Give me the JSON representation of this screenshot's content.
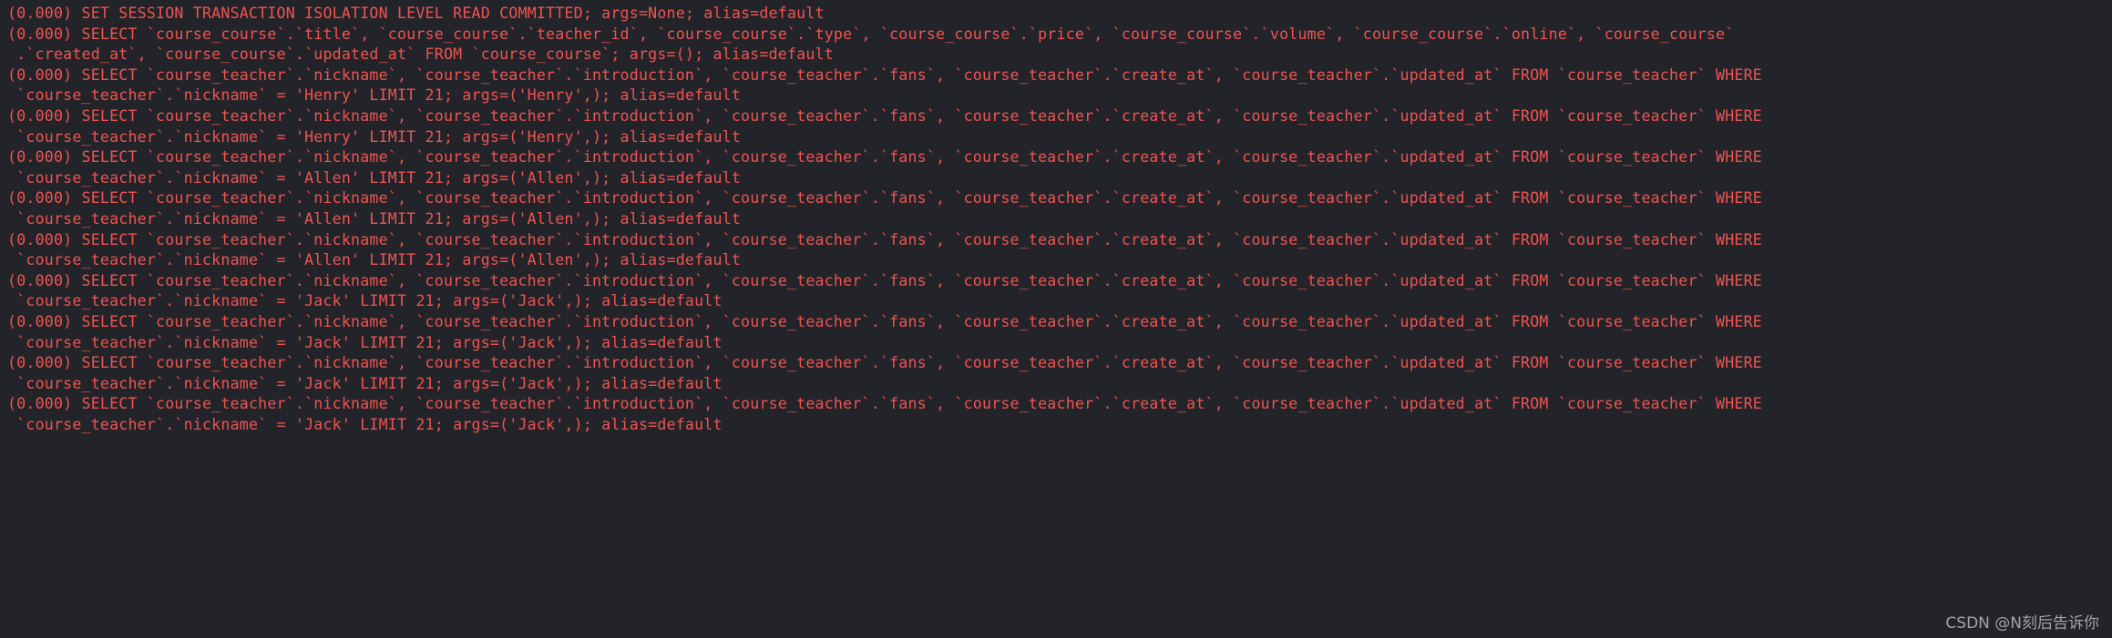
{
  "console": {
    "background_color": "#23242a",
    "text_color": "#ef5350",
    "watermark_color": "#b9babd",
    "font_size_px": 16.6,
    "line_height_px": 22.6,
    "line_count": 30,
    "lines": [
      "(0.000) SET SESSION TRANSACTION ISOLATION LEVEL READ COMMITTED; args=None; alias=default",
      "(0.000) SELECT `course_course`.`title`, `course_course`.`teacher_id`, `course_course`.`type`, `course_course`.`price`, `course_course`.`volume`, `course_course`.`online`, `course_course`",
      " .`created_at`, `course_course`.`updated_at` FROM `course_course`; args=(); alias=default",
      "(0.000) SELECT `course_teacher`.`nickname`, `course_teacher`.`introduction`, `course_teacher`.`fans`, `course_teacher`.`create_at`, `course_teacher`.`updated_at` FROM `course_teacher` WHERE",
      " `course_teacher`.`nickname` = 'Henry' LIMIT 21; args=('Henry',); alias=default",
      "(0.000) SELECT `course_teacher`.`nickname`, `course_teacher`.`introduction`, `course_teacher`.`fans`, `course_teacher`.`create_at`, `course_teacher`.`updated_at` FROM `course_teacher` WHERE",
      " `course_teacher`.`nickname` = 'Henry' LIMIT 21; args=('Henry',); alias=default",
      "(0.000) SELECT `course_teacher`.`nickname`, `course_teacher`.`introduction`, `course_teacher`.`fans`, `course_teacher`.`create_at`, `course_teacher`.`updated_at` FROM `course_teacher` WHERE",
      " `course_teacher`.`nickname` = 'Allen' LIMIT 21; args=('Allen',); alias=default",
      "(0.000) SELECT `course_teacher`.`nickname`, `course_teacher`.`introduction`, `course_teacher`.`fans`, `course_teacher`.`create_at`, `course_teacher`.`updated_at` FROM `course_teacher` WHERE",
      " `course_teacher`.`nickname` = 'Allen' LIMIT 21; args=('Allen',); alias=default",
      "(0.000) SELECT `course_teacher`.`nickname`, `course_teacher`.`introduction`, `course_teacher`.`fans`, `course_teacher`.`create_at`, `course_teacher`.`updated_at` FROM `course_teacher` WHERE",
      " `course_teacher`.`nickname` = 'Allen' LIMIT 21; args=('Allen',); alias=default",
      "(0.000) SELECT `course_teacher`.`nickname`, `course_teacher`.`introduction`, `course_teacher`.`fans`, `course_teacher`.`create_at`, `course_teacher`.`updated_at` FROM `course_teacher` WHERE",
      " `course_teacher`.`nickname` = 'Jack' LIMIT 21; args=('Jack',); alias=default",
      "(0.000) SELECT `course_teacher`.`nickname`, `course_teacher`.`introduction`, `course_teacher`.`fans`, `course_teacher`.`create_at`, `course_teacher`.`updated_at` FROM `course_teacher` WHERE",
      " `course_teacher`.`nickname` = 'Jack' LIMIT 21; args=('Jack',); alias=default",
      "(0.000) SELECT `course_teacher`.`nickname`, `course_teacher`.`introduction`, `course_teacher`.`fans`, `course_teacher`.`create_at`, `course_teacher`.`updated_at` FROM `course_teacher` WHERE",
      " `course_teacher`.`nickname` = 'Jack' LIMIT 21; args=('Jack',); alias=default",
      "(0.000) SELECT `course_teacher`.`nickname`, `course_teacher`.`introduction`, `course_teacher`.`fans`, `course_teacher`.`create_at`, `course_teacher`.`updated_at` FROM `course_teacher` WHERE",
      " `course_teacher`.`nickname` = 'Jack' LIMIT 21; args=('Jack',); alias=default"
    ]
  },
  "watermark": {
    "text": "CSDN @N刻后告诉你"
  }
}
